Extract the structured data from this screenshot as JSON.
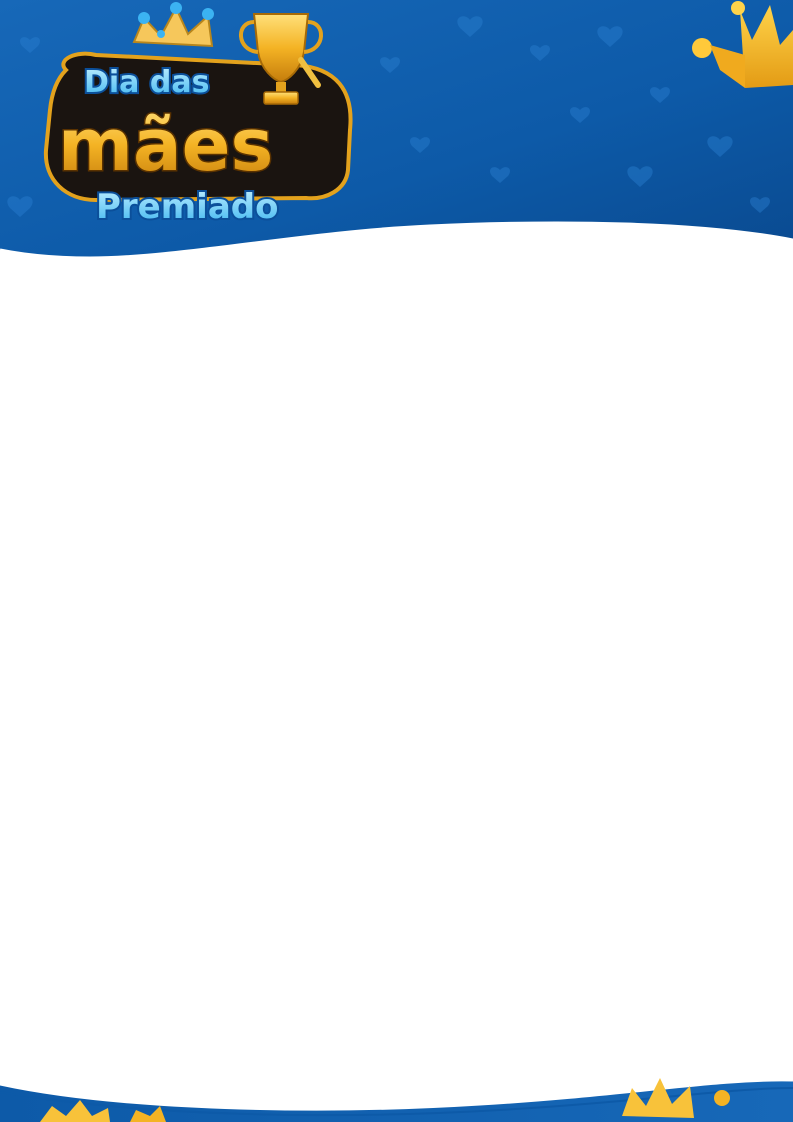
{
  "logo": {
    "line1": "Dia das",
    "line2": "mães",
    "line3": "Premiado"
  },
  "colors": {
    "blue_dark": "#0b4f9a",
    "blue_mid": "#1a6fc2",
    "gold": "#f4b324",
    "gold_dark": "#c57d0c",
    "light_blue_text": "#4cc4f5",
    "white": "#ffffff"
  },
  "icons": {
    "crown": "crown-icon",
    "trophy": "trophy-icon",
    "hearts": "heart-pattern"
  }
}
